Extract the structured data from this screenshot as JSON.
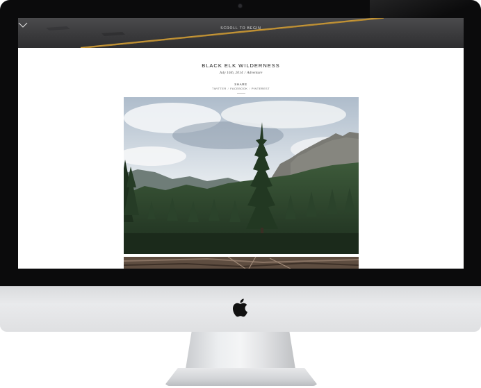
{
  "hero": {
    "scroll_label": "SCROLL TO BEGIN"
  },
  "post": {
    "title": "BLACK ELK WILDERNESS",
    "date": "July 16th, 2014",
    "separator": "/",
    "category": "Adventure"
  },
  "share": {
    "label": "SHARE",
    "links": [
      "TWITTER",
      "FACEBOOK",
      "PINTEREST"
    ],
    "link_separator": "/"
  },
  "icons": {
    "scroll": "chevron-down-icon",
    "logo": "apple-logo-icon"
  },
  "colors": {
    "hero_background": "#3b3b3d",
    "road_line": "#c99a3a",
    "bezel": "#0b0b0c",
    "chin": "#e4e5e7"
  }
}
